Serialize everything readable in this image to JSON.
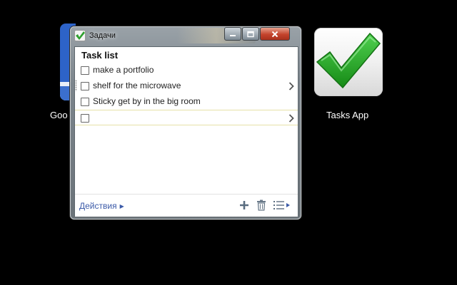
{
  "desktop": {
    "google_icon_label": "Goo",
    "tasks_app_label": "Tasks App"
  },
  "window": {
    "title": "Задачи",
    "buttons": {
      "minimize": "minimize",
      "maximize": "maximize",
      "close": "close"
    },
    "list_title": "Task list",
    "tasks": [
      {
        "text": "make a portfolio",
        "checked": false,
        "has_details": false
      },
      {
        "text": "shelf for the microwave",
        "checked": false,
        "has_details": true
      },
      {
        "text": "Sticky get by in the big room",
        "checked": false,
        "has_details": false
      },
      {
        "text": "",
        "checked": false,
        "has_details": true
      }
    ],
    "footer": {
      "actions_label": "Действия",
      "icons": [
        "add-task-icon",
        "trash-icon",
        "list-menu-icon"
      ]
    }
  },
  "colors": {
    "link": "#3b5aa8",
    "checkmark_green": "#2fa02f",
    "close_red": "#c4432c"
  }
}
